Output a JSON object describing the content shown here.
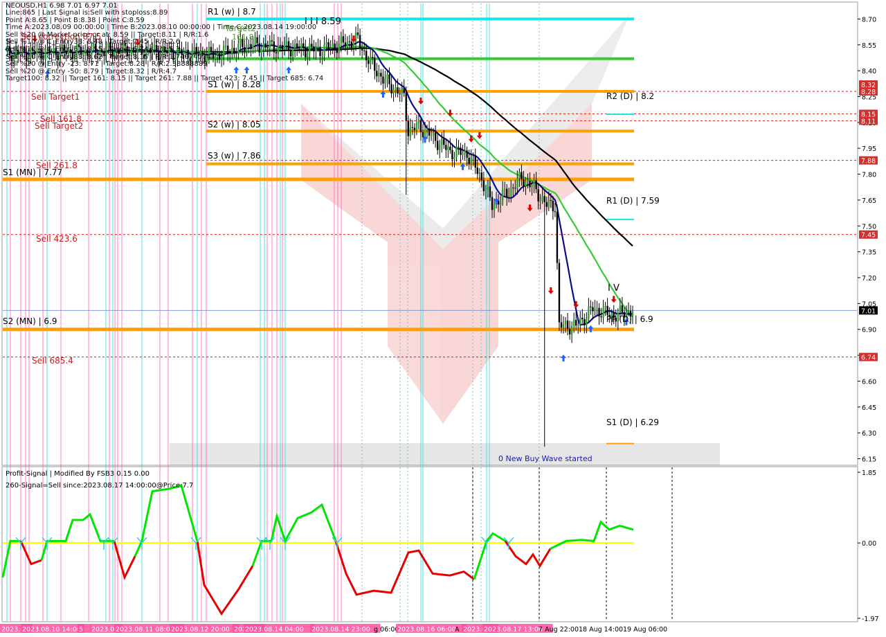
{
  "symbol_header": "NEOUSD,H1  6.98 7.01 6.97 7.01",
  "info_lines": [
    "Line:865 | Last Signal is:Sell with stoploss:8.89",
    "Point A:8.65 | Point B:8.38 | Point C:8.59",
    "Time A:2023.08.09 00:00:00 | Time B:2023.08.10 00:00:00 | Time C:2023.08.14 19:00:00",
    "Sell %20 @ Market price or at: 8.59 || Target:8.11 | R/R:1.6",
    "Sell %10 @ C_Entry38: 8.48 | Target:7.45 | R/R:2.6",
    "Sell %10 @ C_Entry61: 8.55 | Target:6.74 | R/R:5.3",
    "Sell %10 @ C_Entry88: 8.62 | Target:8.15 | R/R:1.74074074",
    "Sell %20 @ Entry -23: 8.71 | Target:8.28 | R/R:2.38888889",
    "Sell %20 @ Entry -50: 8.79 | Target:8.32 | R/R:4.7",
    "Target100: 8.32 || Target 161: 8.15 || Target 261: 7.88 || Target 423: 7.45 || Target 685: 6.74"
  ],
  "chart_data": [
    {
      "type": "candlestick",
      "title": "NEOUSD,H1",
      "ylim": [
        6.12,
        8.79
      ],
      "price_axis_ticks": [
        "8.70",
        "8.55",
        "8.40",
        "8.25",
        "8.10",
        "7.95",
        "7.80",
        "7.65",
        "7.50",
        "7.35",
        "7.20",
        "7.05",
        "6.90",
        "6.75",
        "6.60",
        "6.45",
        "6.30",
        "6.15"
      ],
      "current_price": 7.01,
      "price_tags": [
        {
          "label": "8.32",
          "color": "#d0302e"
        },
        {
          "label": "8.28",
          "color": "#d0302e"
        },
        {
          "label": "8.15",
          "color": "#d0302e"
        },
        {
          "label": "8.11",
          "color": "#d0302e"
        },
        {
          "label": "7.88",
          "color": "#d0302e"
        },
        {
          "label": "7.45",
          "color": "#d0302e"
        },
        {
          "label": "6.74",
          "color": "#d0302e"
        },
        {
          "label": "7.01",
          "color": "#000000"
        }
      ],
      "pivot_levels": [
        {
          "label": "R1 (w) | 8.7",
          "value": 8.7,
          "color": "#19e5e5"
        },
        {
          "label": "S1 (w) | 8.28",
          "value": 8.28,
          "color": "#ffa000"
        },
        {
          "label": "S2 (w) | 8.05",
          "value": 8.05,
          "color": "#ffa000"
        },
        {
          "label": "S3 (w) | 7.86",
          "value": 7.86,
          "color": "#ffa000"
        },
        {
          "label": "S1 (MN) | 7.77",
          "value": 7.77,
          "color": "#ffa000"
        },
        {
          "label": "S2 (MN) | 6.9",
          "value": 6.9,
          "color": "#ffa000"
        }
      ],
      "daily_pivots": [
        {
          "label": "R2 (D) | 8.2",
          "value": 8.2,
          "color": "#19e5e5"
        },
        {
          "label": "R1 (D) | 7.59",
          "value": 7.59,
          "color": "#19e5e5"
        },
        {
          "label": "PP (D) | 6.9",
          "value": 6.9,
          "color": "#19e5e5"
        },
        {
          "label": "S1 (D) | 6.29",
          "value": 6.29,
          "color": "#ffa000"
        }
      ],
      "target_lines": [
        {
          "label": "Sell Target1",
          "value": 8.28
        },
        {
          "label": "Sell 161.8",
          "value": 8.15
        },
        {
          "label": "Sell Target2",
          "value": 8.11
        },
        {
          "label": "Sell 261.8",
          "value": 7.88
        },
        {
          "label": "Sell 423.6",
          "value": 7.45
        },
        {
          "label": "Sell 685.4",
          "value": 6.74
        },
        {
          "label": "Sell correction 87.5",
          "value": 8.62
        }
      ],
      "wave_labels": [
        "I I I 8.59",
        "I V",
        "Target2",
        "161.8",
        "0 New Buy Wave started"
      ],
      "colors": {
        "ma_black": "#000000",
        "ma_green": "#35c935",
        "ma_navy": "#0a0a8c",
        "bull": "#2aa52a",
        "bear": "#000000",
        "up_arrow": "#1e64ff",
        "down_arrow": "#e00000"
      }
    },
    {
      "type": "line",
      "title": "Profit-Signal | Modified By FSB3 0.15 0.00",
      "subtitle": "260-Signal=Sell since:2023.08.17 14:00:00@Price:7.7",
      "ylim": [
        -1.97,
        1.85
      ],
      "axis_ticks": [
        "1.85",
        "0.00",
        "-1.97"
      ],
      "zero_line_color": "#ffff00",
      "positive_color": "#00e600",
      "negative_color": "#e60000"
    }
  ],
  "time_axis_labels": [
    "2023.08",
    "2023.08.10 14:00",
    "5",
    "2023.08",
    "2023.08.11 08:00",
    "2023.08.12 20:00",
    "2023.08",
    "2023.08.14 04:00",
    "2023.08.14 23:00",
    "g 06:00",
    "2023.08.16 06:00",
    "A",
    "2023.08.",
    "2023.08.17 13:00",
    "7 Aug 22:00",
    "18 Aug 14:00",
    "19 Aug 06:00"
  ]
}
